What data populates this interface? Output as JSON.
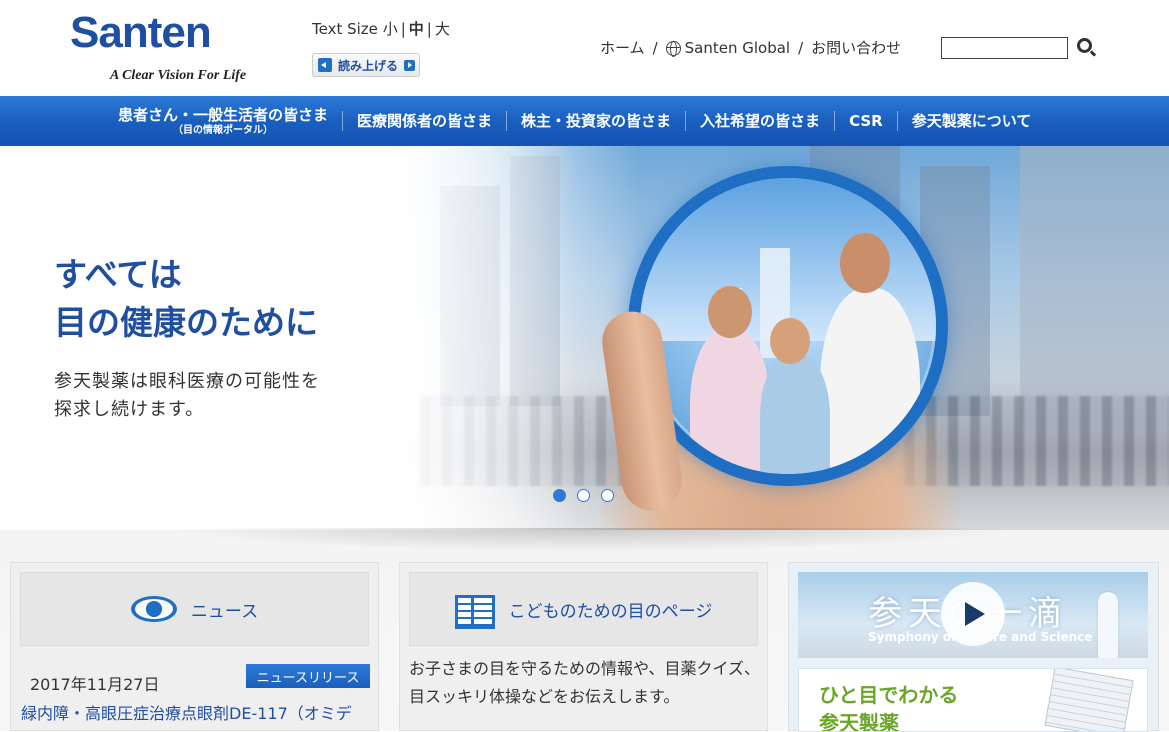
{
  "header": {
    "logo_word": "Santen",
    "logo_tagline": "A Clear Vision For Life",
    "text_size_label": "Text Size",
    "text_sizes": [
      "小",
      "中",
      "大"
    ],
    "read_aloud_label": "読み上げる",
    "util_nav": [
      "ホーム",
      "Santen Global",
      "お問い合わせ"
    ],
    "search": {
      "value": ""
    }
  },
  "global_nav": [
    {
      "label": "患者さん・一般生活者の皆さま",
      "sub": "（目の情報ポータル）"
    },
    {
      "label": "医療関係者の皆さま"
    },
    {
      "label": "株主・投資家の皆さま"
    },
    {
      "label": "入社希望の皆さま"
    },
    {
      "label": "CSR"
    },
    {
      "label": "参天製薬について"
    }
  ],
  "hero": {
    "title_line1": "すべては",
    "title_line2": "目の健康のために",
    "sub_line1": "参天製薬は眼科医療の可能性を",
    "sub_line2": "探求し続けます。",
    "slide_count": 3,
    "active_slide": 1
  },
  "news": {
    "heading": "ニュース",
    "date": "2017年11月27日",
    "badge": "ニュースリリース",
    "link": "緑内障・高眼圧症治療点眼剤DE-117（オミデ"
  },
  "kids": {
    "heading": "こどものための目のページ",
    "description": "お子さまの目を守るための情報や、目薬クイズ、目スッキリ体操などをお伝えします。"
  },
  "promo": {
    "movie_title": "参天の一滴",
    "movie_subtitle": "Symphony of Nature and Science",
    "glance_line1": "ひと目でわかる",
    "glance_line2": "参天製薬"
  },
  "colors": {
    "brand_blue": "#1f4fa0",
    "nav_blue": "#1a5fbf",
    "accent_green": "#6aa62a"
  }
}
